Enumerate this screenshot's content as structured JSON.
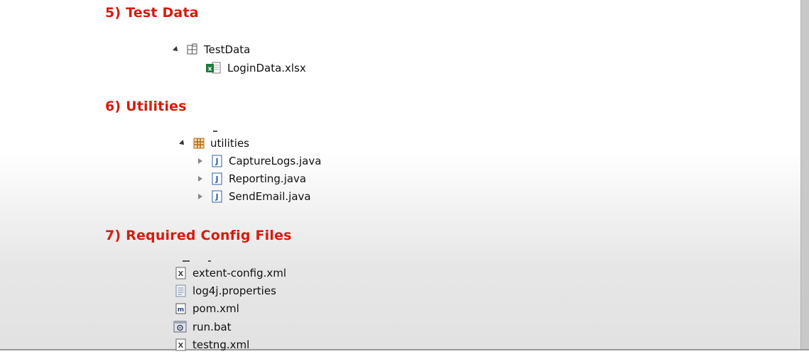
{
  "sections": {
    "test_data": {
      "heading": "5) Test Data",
      "folder": "TestData",
      "file": "LoginData.xlsx"
    },
    "utilities": {
      "heading": "6) Utilities",
      "package": "utilities",
      "files": [
        "CaptureLogs.java",
        "Reporting.java",
        "SendEmail.java"
      ]
    },
    "config": {
      "heading": "7) Required Config Files",
      "files": [
        "extent-config.xml",
        "log4j.properties",
        "pom.xml",
        "run.bat",
        "testng.xml"
      ]
    }
  },
  "icons": {
    "folder": "folder-icon",
    "excel": "excel-file-icon",
    "package": "package-icon",
    "java": "java-file-icon",
    "xml": "xml-file-icon",
    "properties": "properties-file-icon",
    "maven": "maven-pom-icon",
    "batch": "batch-file-icon"
  },
  "colors": {
    "heading": "#d51c0d",
    "java_icon": "#2f5fa8",
    "excel_icon": "#1e7b3c",
    "package_icon": "#b06a1a"
  }
}
